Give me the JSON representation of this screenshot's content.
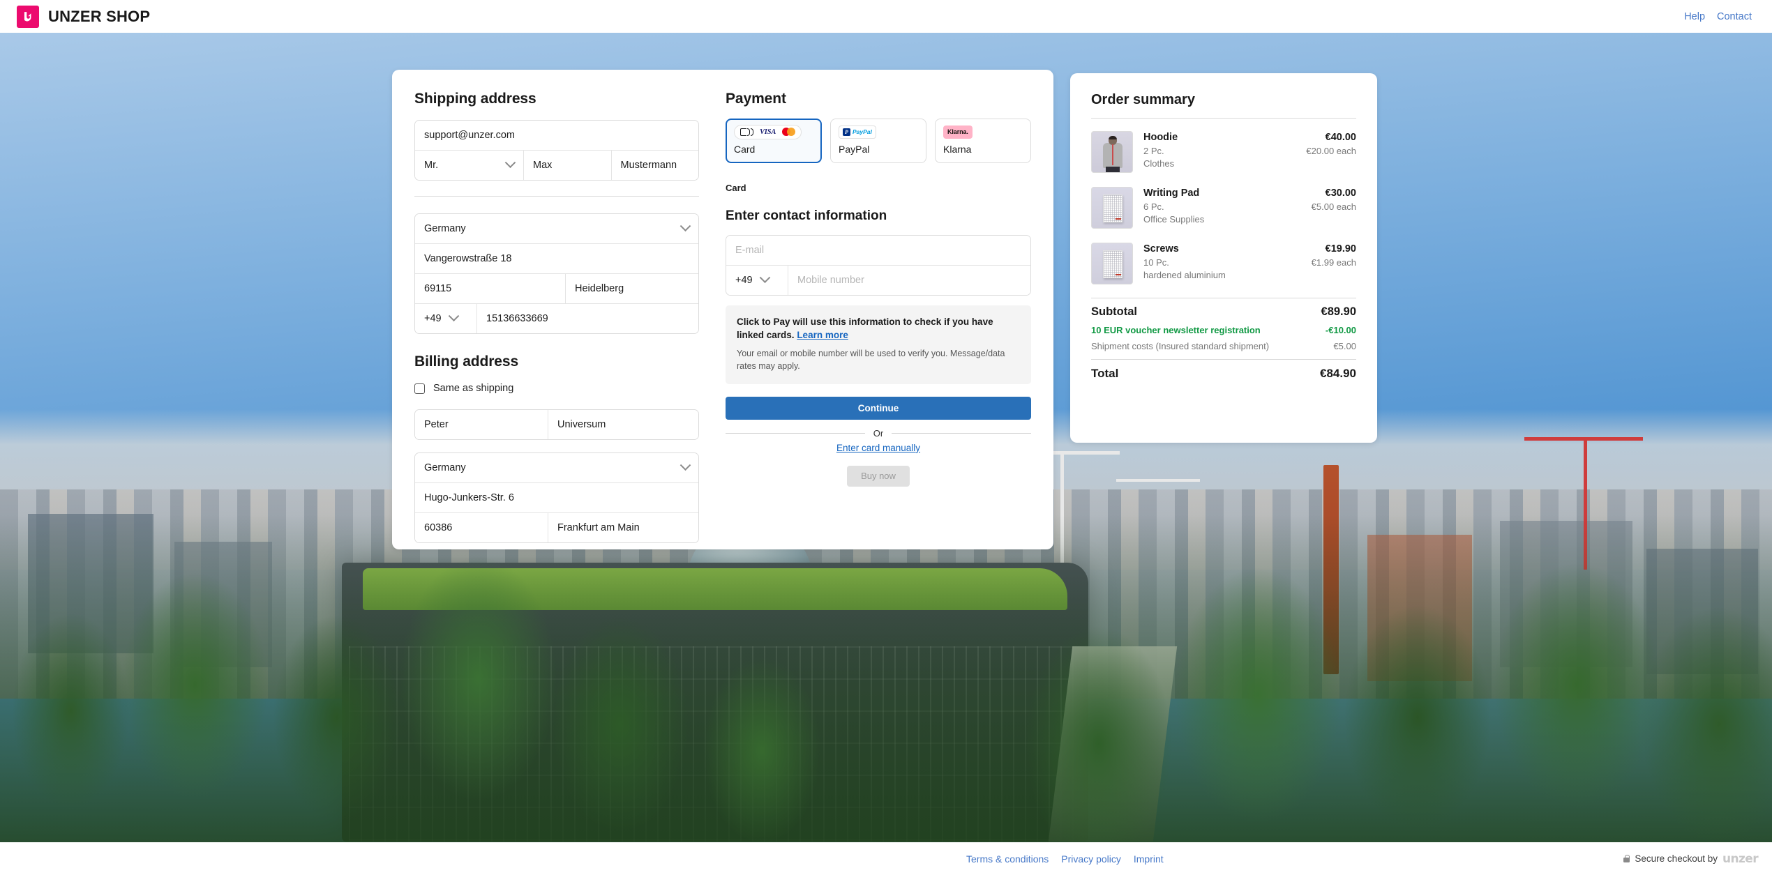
{
  "header": {
    "brand_name": "UNZER SHOP",
    "logo_icon": "unzer-logo-icon",
    "links": [
      {
        "label": "Help"
      },
      {
        "label": "Contact"
      }
    ]
  },
  "shipping": {
    "title": "Shipping address",
    "email": "support@unzer.com",
    "email_placeholder": "E-mail",
    "salutation": "Mr.",
    "first_name": "Max",
    "last_name": "Mustermann",
    "country": "Germany",
    "street": "Vangerowstraße 18",
    "zip": "69115",
    "city": "Heidelberg",
    "phone_code": "+49",
    "phone_number": "15136633669"
  },
  "billing": {
    "title": "Billing address",
    "same_as_shipping_label": "Same as shipping",
    "same_as_shipping_checked": false,
    "first_name": "Peter",
    "last_name": "Universum",
    "country": "Germany",
    "street": "Hugo-Junkers-Str. 6",
    "zip": "60386",
    "city": "Frankfurt am Main"
  },
  "payment": {
    "title": "Payment",
    "selected_method": "Card",
    "methods": [
      {
        "label": "Card",
        "badge": "card-brands-badge",
        "selected": true
      },
      {
        "label": "PayPal",
        "badge": "paypal-badge",
        "selected": false
      },
      {
        "label": "Klarna",
        "badge": "klarna-badge",
        "selected": false
      }
    ],
    "selected_caption": "Card",
    "brand_visa": "VISA",
    "brand_klarna": "Klarna.",
    "brand_paypal": "PayPal",
    "paypal_p": "P",
    "click_to_pay": {
      "heading": "Enter contact information",
      "email_placeholder": "E-mail",
      "email_value": "",
      "phone_code": "+49",
      "phone_placeholder": "Mobile number",
      "phone_value": "",
      "notice_strong": "Click to Pay will use this information to check if you have linked cards.",
      "notice_link": "Learn more",
      "notice_sub": "Your email or mobile number will be used to verify you. Message/data rates may apply.",
      "continue_label": "Continue",
      "or_label": "Or",
      "manual_link": "Enter card manually",
      "buy_now_label": "Buy now"
    }
  },
  "order_summary": {
    "title": "Order summary",
    "items": [
      {
        "name": "Hoodie",
        "qty": "2 Pc.",
        "category": "Clothes",
        "price": "€40.00",
        "each": "€20.00 each",
        "thumb": "hoodie-thumbnail"
      },
      {
        "name": "Writing Pad",
        "qty": "6 Pc.",
        "category": "Office Supplies",
        "price": "€30.00",
        "each": "€5.00 each",
        "thumb": "writing-pad-thumbnail"
      },
      {
        "name": "Screws",
        "qty": "10 Pc.",
        "category": "hardened aluminium",
        "price": "€19.90",
        "each": "€1.99 each",
        "thumb": "screws-thumbnail"
      }
    ],
    "subtotal_label": "Subtotal",
    "subtotal_value": "€89.90",
    "discount_label": "10 EUR voucher newsletter registration",
    "discount_value": "-€10.00",
    "shipping_label": "Shipment costs (Insured standard shipment)",
    "shipping_value": "€5.00",
    "total_label": "Total",
    "total_value": "€84.90"
  },
  "footer": {
    "links": [
      {
        "label": "Terms & conditions"
      },
      {
        "label": "Privacy policy"
      },
      {
        "label": "Imprint"
      }
    ],
    "secure_text": "Secure checkout by",
    "secure_brand": "unzer",
    "lock_icon": "lock-icon"
  },
  "colors": {
    "brand_pink": "#ec0b6e",
    "accent_blue": "#1565c0",
    "button_blue": "#2970b8",
    "discount_green": "#119944",
    "link_blue": "#4678c8"
  }
}
